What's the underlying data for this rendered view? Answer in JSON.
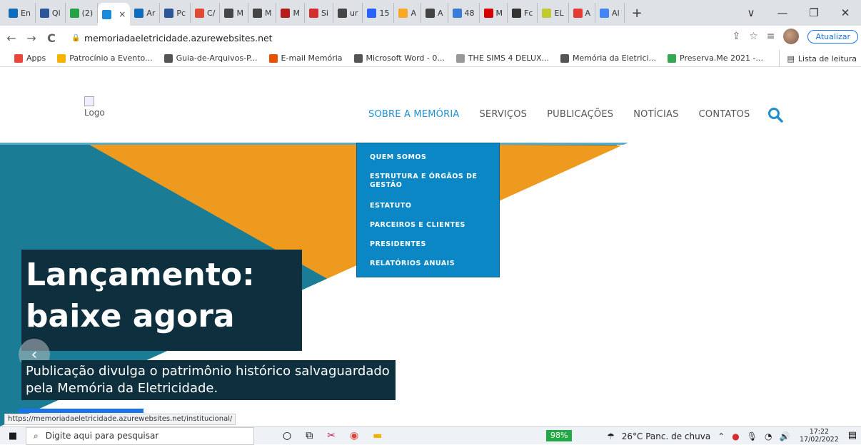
{
  "browser": {
    "tabs": [
      {
        "label": "En",
        "color": "#0f6cbd"
      },
      {
        "label": "Ql",
        "color": "#2b579a"
      },
      {
        "label": "(2)",
        "color": "#25a244"
      },
      {
        "label": "",
        "color": "#1c8adb",
        "active": true
      },
      {
        "label": "Ar",
        "color": "#0f6cbd"
      },
      {
        "label": "Pc",
        "color": "#2b579a"
      },
      {
        "label": "C/",
        "color": "#e34a33"
      },
      {
        "label": "M",
        "color": "#444444"
      },
      {
        "label": "M",
        "color": "#444444"
      },
      {
        "label": "M",
        "color": "#b71c1c"
      },
      {
        "label": "Si",
        "color": "#d32f2f"
      },
      {
        "label": "ur",
        "color": "#444444"
      },
      {
        "label": "15",
        "color": "#2962ff"
      },
      {
        "label": "A",
        "color": "#f9a825"
      },
      {
        "label": "A",
        "color": "#444444"
      },
      {
        "label": "48",
        "color": "#3a7bd5"
      },
      {
        "label": "M",
        "color": "#d50000"
      },
      {
        "label": "Fc",
        "color": "#333333"
      },
      {
        "label": "EL",
        "color": "#c0ca33"
      },
      {
        "label": "A",
        "color": "#e53935"
      },
      {
        "label": "Al",
        "color": "#4285f4"
      }
    ],
    "active_tab_close": "×",
    "new_tab": "+",
    "window_controls": {
      "minimize": "—",
      "restore": "❐",
      "close": "✕",
      "tab_search": "∨"
    },
    "nav": {
      "back": "←",
      "forward": "→",
      "reload": "C"
    },
    "url": "memoriadaeletricidade.azurewebsites.net",
    "update_button": "Atualizar",
    "bookmarks": [
      {
        "label": "Apps",
        "color": "#e8453c"
      },
      {
        "label": "Patrocínio a Evento...",
        "color": "#f4b400"
      },
      {
        "label": "Guia-de-Arquivos-P...",
        "color": "#555555"
      },
      {
        "label": "E-mail Memória",
        "color": "#e65100"
      },
      {
        "label": "Microsoft Word - 0...",
        "color": "#555555"
      },
      {
        "label": "THE SIMS 4 DELUX...",
        "color": "#999999"
      },
      {
        "label": "Memória da Eletrici...",
        "color": "#555555"
      },
      {
        "label": "Preserva.Me 2021 -...",
        "color": "#34a853"
      }
    ],
    "reading_list": "Lista de leitura",
    "status_url": "https://memoriadaeletricidade.azurewebsites.net/institucional/"
  },
  "site": {
    "logo_alt": "Logo",
    "nav": [
      {
        "label": "SOBRE A MEMÓRIA",
        "active": true
      },
      {
        "label": "SERVIÇOS"
      },
      {
        "label": "PUBLICAÇÕES"
      },
      {
        "label": "NOTÍCIAS"
      },
      {
        "label": "CONTATOS"
      }
    ],
    "dropdown": [
      "QUEM SOMOS",
      "ESTRUTURA E ÓRGÃOS DE GESTÃO",
      "ESTATUTO",
      "PARCEIROS E CLIENTES",
      "PRESIDENTES",
      "RELATÓRIOS ANUAIS"
    ],
    "hero": {
      "headline_line1": "Lançamento:",
      "headline_line2": "baixe agora",
      "subtitle_line1": "Publicação divulga o patrimônio histórico salvaguardado",
      "subtitle_line2": "pela Memória da Eletricidade.",
      "prev_arrow": "‹"
    },
    "colors": {
      "accent": "#1f8fcf",
      "hero_orange": "#ee9a1f",
      "hero_teal": "#1b7d95",
      "hero_dark": "#0e2f3d",
      "dropdown_bg": "#0a87c4"
    }
  },
  "taskbar": {
    "search_placeholder": "Digite aqui para pesquisar",
    "battery": "98%",
    "weather": "26°C  Panc. de chuva",
    "time": "17:22",
    "date": "17/02/2022"
  }
}
